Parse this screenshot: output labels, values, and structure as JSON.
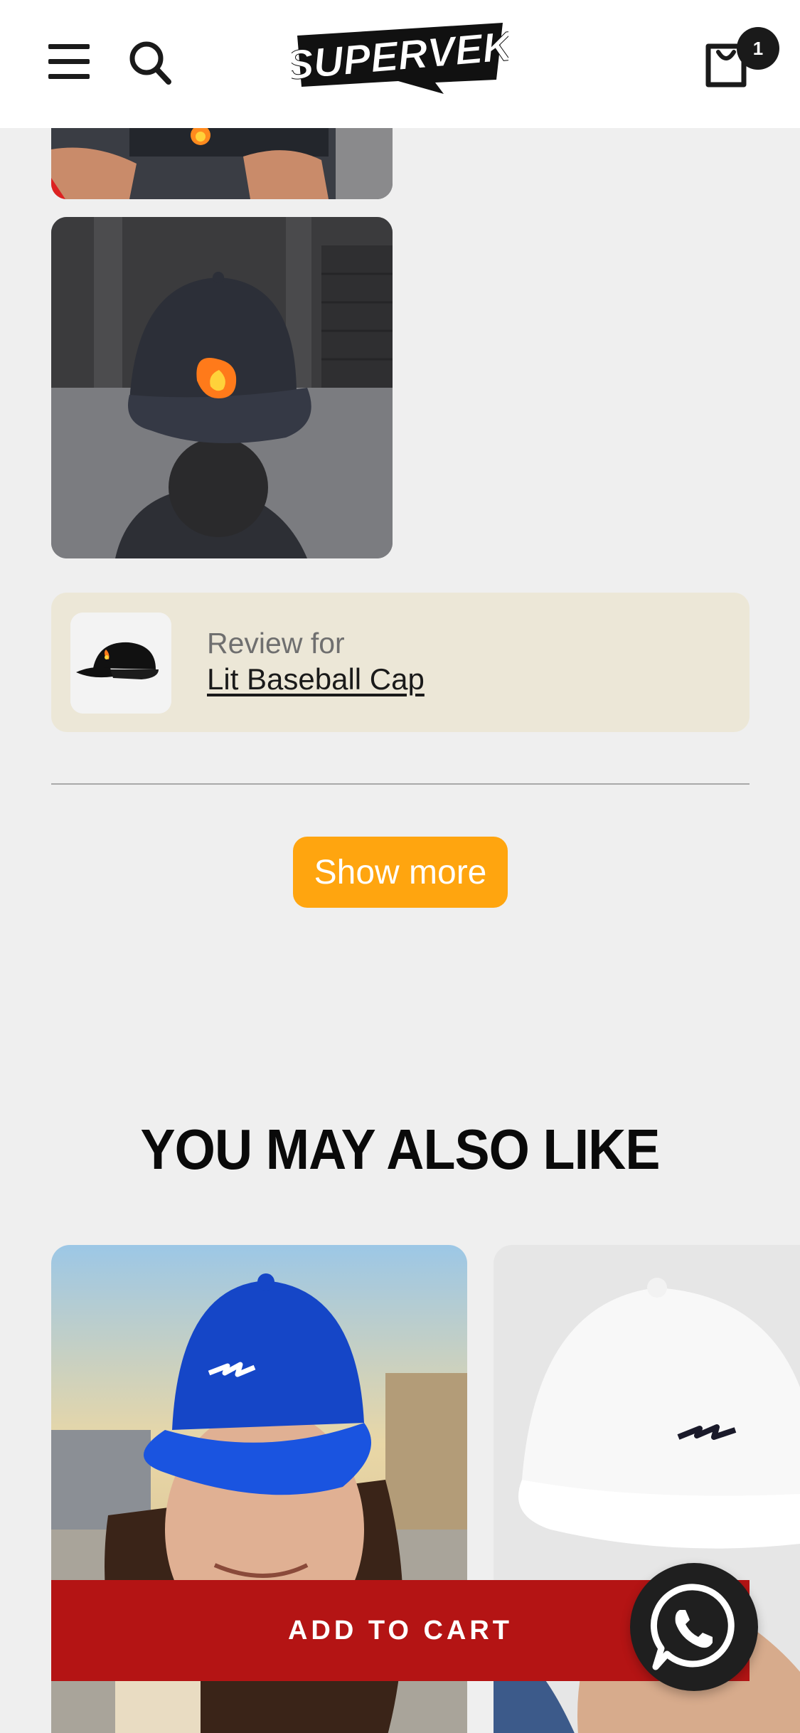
{
  "header": {
    "brand": "SUPERVEK",
    "cart_count": "1"
  },
  "review": {
    "label": "Review for",
    "product_name": "Lit Baseball Cap"
  },
  "show_more_label": "Show more",
  "recommendations": {
    "title": "YOU MAY ALSO LIKE"
  },
  "sticky": {
    "add_to_cart_label": "ADD TO CART"
  },
  "colors": {
    "accent_orange": "#ffa50f",
    "cta_red": "#b41414",
    "review_card_bg": "#ece7d7",
    "page_bg": "#efefef"
  },
  "icons": [
    "menu-icon",
    "search-icon",
    "cart-icon",
    "whatsapp-icon"
  ]
}
